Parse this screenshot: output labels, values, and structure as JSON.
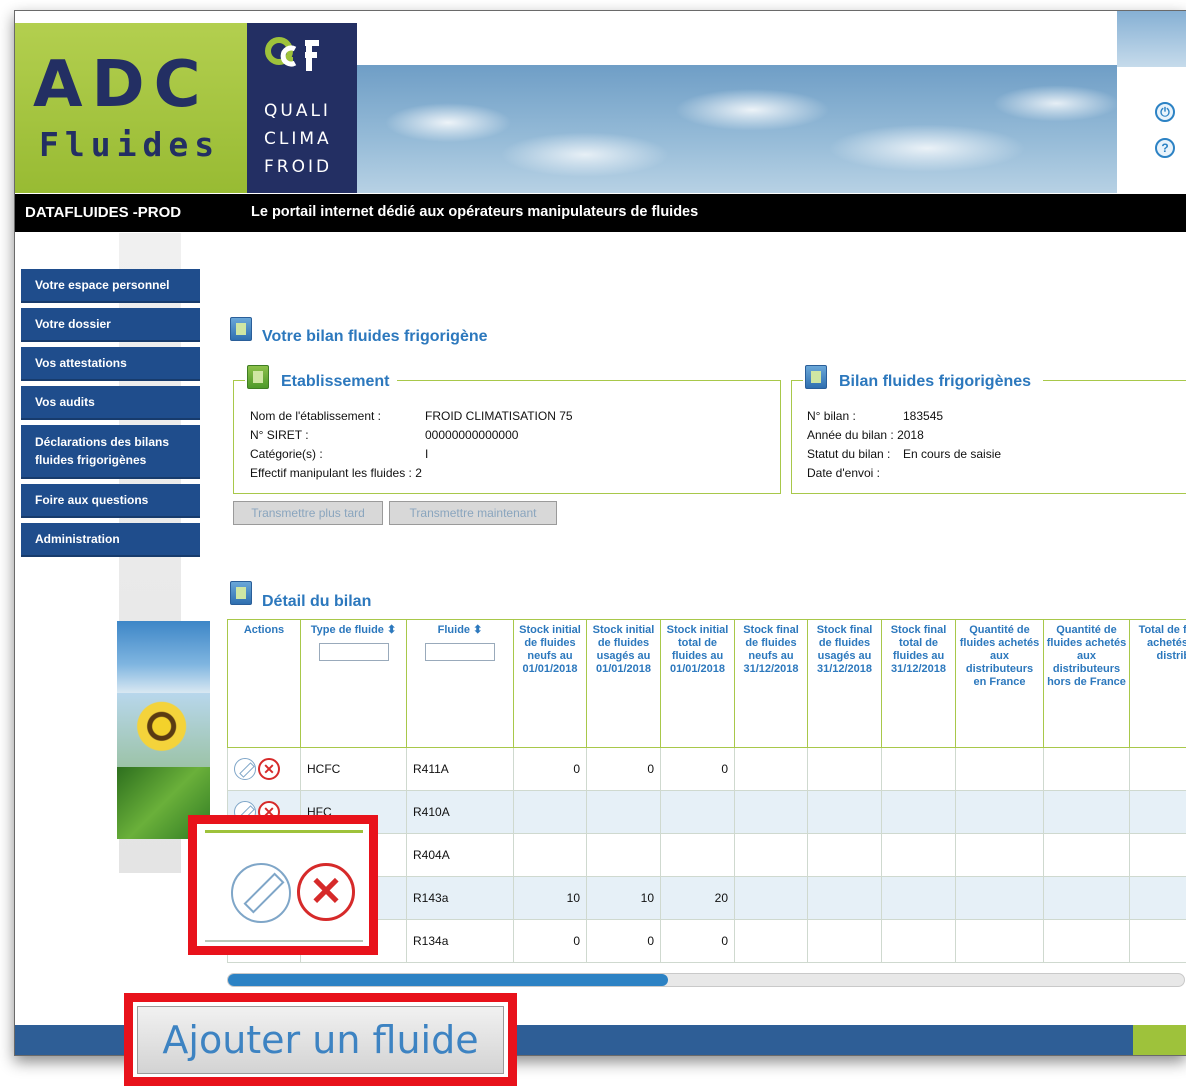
{
  "header": {
    "logo_adc": "ADC",
    "logo_fluides": "Fluides",
    "qcf_lines": [
      "QUALI",
      "CLIMA",
      "FROID"
    ],
    "icons": [
      "power-icon",
      "help-icon"
    ]
  },
  "topbar": {
    "app_name": "DATAFLUIDES -PROD",
    "tagline": "Le portail internet dédié aux opérateurs manipulateurs de fluides"
  },
  "nav": {
    "items": [
      {
        "label": "Votre espace personnel"
      },
      {
        "label": "Votre dossier"
      },
      {
        "label": "Vos attestations"
      },
      {
        "label": "Vos audits"
      },
      {
        "label": "Déclarations des bilans fluides frigorigènes"
      },
      {
        "label": "Foire aux questions"
      },
      {
        "label": "Administration"
      }
    ]
  },
  "page": {
    "title": "Votre bilan fluides frigorigène"
  },
  "etablissement": {
    "legend": "Etablissement",
    "labels": [
      "Nom de l'établissement :",
      "N° SIRET :",
      "Catégorie(s) :",
      "Effectif manipulant les fluides : 2"
    ],
    "values": [
      "FROID CLIMATISATION 75",
      "00000000000000",
      "I"
    ]
  },
  "bilan": {
    "legend": "Bilan fluides frigorigènes",
    "labels": [
      "N° bilan :",
      "Année du bilan : 2018",
      "Statut du bilan :",
      "Date d'envoi :"
    ],
    "values": [
      "183545",
      "En cours de saisie"
    ]
  },
  "buttons": {
    "later": "Transmettre plus tard",
    "now": "Transmettre maintenant",
    "add": "Ajouter un fluide"
  },
  "detail": {
    "title": "Détail du bilan",
    "columns": [
      "Actions",
      "Type de fluide ⬍",
      "Fluide ⬍",
      "Stock initial de fluides neufs au 01/01/2018",
      "Stock initial de fluides usagés au 01/01/2018",
      "Stock initial total de fluides au 01/01/2018",
      "Stock final de fluides neufs au 31/12/2018",
      "Stock final de fluides usagés au 31/12/2018",
      "Stock final total de fluides au 31/12/2018",
      "Quantité de fluides achetés aux distributeurs en France",
      "Quantité de fluides achetés aux distributeurs hors de France",
      "Total de fluides achetés aux distribut"
    ],
    "rows": [
      {
        "type": "HCFC",
        "fluide": "R411A",
        "c1": "0",
        "c2": "0",
        "c3": "0"
      },
      {
        "type": "HFC",
        "fluide": "R410A",
        "c1": "",
        "c2": "",
        "c3": ""
      },
      {
        "type": "",
        "fluide": "R404A",
        "c1": "",
        "c2": "",
        "c3": ""
      },
      {
        "type": "",
        "fluide": "R143a",
        "c1": "10",
        "c2": "10",
        "c3": "20"
      },
      {
        "type": "",
        "fluide": "R134a",
        "c1": "0",
        "c2": "0",
        "c3": "0"
      }
    ],
    "scroll_fraction": 0.46
  },
  "colors": {
    "nav": "#1f4d8c",
    "accent_blue": "#2c78bd",
    "border_green": "#a8c84a",
    "highlight_red": "#e8121b"
  }
}
